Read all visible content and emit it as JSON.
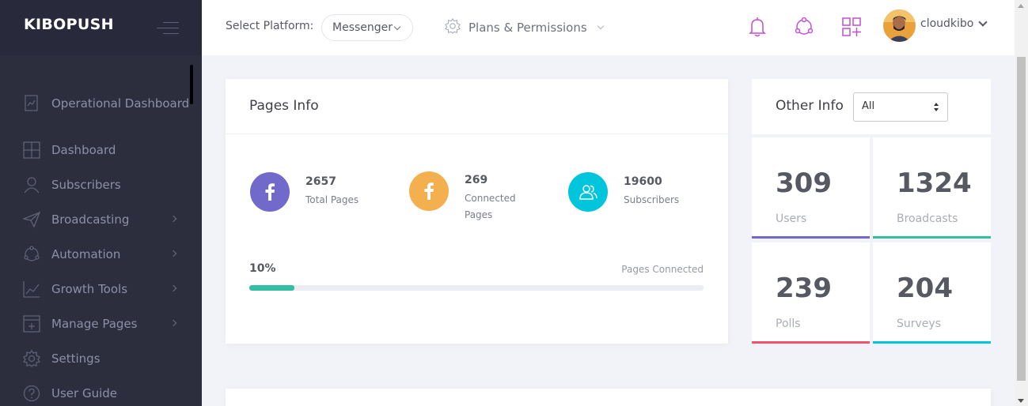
{
  "brand": {
    "name": "KIBOPUSH"
  },
  "sidebar": {
    "items": [
      {
        "label": "Operational Dashboard",
        "icon": "operational-dashboard-icon",
        "has_submenu": false
      },
      {
        "label": "Dashboard",
        "icon": "dashboard-grid-icon",
        "has_submenu": false
      },
      {
        "label": "Subscribers",
        "icon": "subscriber-icon",
        "has_submenu": false
      },
      {
        "label": "Broadcasting",
        "icon": "paper-plane-icon",
        "has_submenu": true
      },
      {
        "label": "Automation",
        "icon": "automation-icon",
        "has_submenu": true
      },
      {
        "label": "Growth Tools",
        "icon": "growth-chart-icon",
        "has_submenu": true
      },
      {
        "label": "Manage Pages",
        "icon": "pages-icon",
        "has_submenu": true
      },
      {
        "label": "Settings",
        "icon": "gear-icon",
        "has_submenu": false
      },
      {
        "label": "User Guide",
        "icon": "help-icon",
        "has_submenu": false
      }
    ]
  },
  "header": {
    "platform_label": "Select Platform:",
    "platform_value": "Messenger",
    "plans_label": "Plans & Permissions",
    "username": "cloudkibo",
    "icon_color": "#c24ed2"
  },
  "pages_info": {
    "title": "Pages Info",
    "stats": [
      {
        "value": "2657",
        "label": "Total Pages",
        "icon": "facebook-icon",
        "color": "#716aca"
      },
      {
        "value": "269",
        "label": "Connected Pages",
        "icon": "facebook-icon",
        "color": "#f4b04f"
      },
      {
        "value": "19600",
        "label": "Subscribers",
        "icon": "users-icon",
        "color": "#00c5dc"
      }
    ],
    "progress": {
      "percent_label": "10%",
      "fraction": 0.1,
      "label": "Pages Connected",
      "color": "#34bfa3"
    }
  },
  "other_info": {
    "title": "Other Info",
    "filter_value": "All",
    "metrics": [
      {
        "value": "309",
        "label": "Users",
        "color": "#716aca"
      },
      {
        "value": "1324",
        "label": "Broadcasts",
        "color": "#34bfa3"
      },
      {
        "value": "239",
        "label": "Polls",
        "color": "#f4516c"
      },
      {
        "value": "204",
        "label": "Surveys",
        "color": "#00c5dc"
      }
    ]
  }
}
